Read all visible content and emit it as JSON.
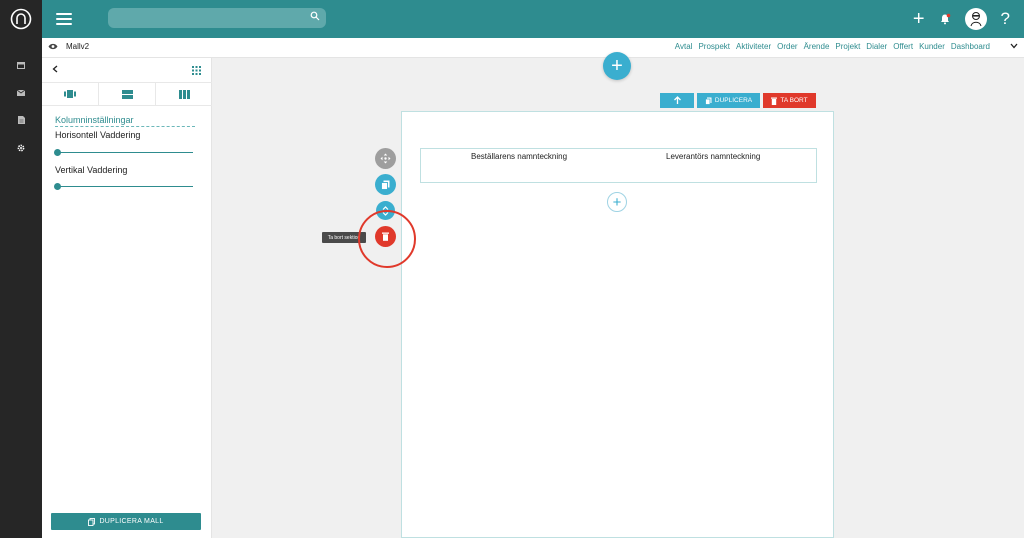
{
  "rail": {
    "items": [
      {
        "icon": "calendar-icon"
      },
      {
        "icon": "mail-icon"
      },
      {
        "icon": "document-icon"
      },
      {
        "icon": "gear-icon"
      }
    ]
  },
  "search": {
    "placeholder": ""
  },
  "template": {
    "name": "Mallv2"
  },
  "nav": [
    "Avtal",
    "Prospekt",
    "Aktiviteter",
    "Order",
    "Ärende",
    "Projekt",
    "Dialer",
    "Offert",
    "Kunder",
    "Dashboard"
  ],
  "panel": {
    "column_settings": "Kolumninställningar",
    "horizontal_padding": "Horisontell Vaddering",
    "vertical_padding": "Vertikal Vaddering",
    "horizontal_padding_value": 0,
    "vertical_padding_value": 0,
    "duplicate_template": "DUPLICERA MALL"
  },
  "toolbar": {
    "duplicate": "DUPLICERA",
    "delete": "TA BORT"
  },
  "section": {
    "signature_left": "Beställarens namnteckning",
    "signature_right": "Leverantörs namnteckning"
  },
  "tooltip": {
    "delete_section": "Ta bort sektion"
  },
  "colors": {
    "brand": "#2e8c8f",
    "action": "#3aaecf",
    "danger": "#e0392b"
  }
}
